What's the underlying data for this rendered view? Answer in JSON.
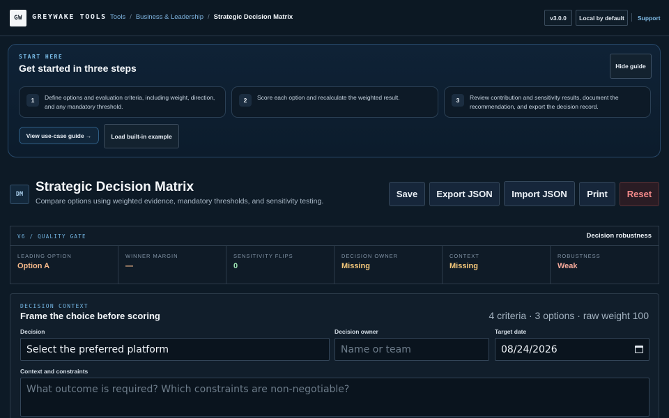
{
  "topbar": {
    "logo": "GW",
    "brand": "GREYWAKE TOOLS",
    "breadcrumb": [
      "Tools",
      "Business & Leadership",
      "Strategic Decision Matrix"
    ],
    "version": "v3.0.0",
    "local_label": "Local by default",
    "support_label": "Support"
  },
  "guide": {
    "kicker": "START HERE",
    "title": "Get started in three steps",
    "hide_label": "Hide guide",
    "steps": [
      {
        "num": "1",
        "text": "Define options and evaluation criteria, including weight, direction, and any mandatory threshold."
      },
      {
        "num": "2",
        "text": "Score each option and recalculate the weighted result."
      },
      {
        "num": "3",
        "text": "Review contribution and sensitivity results, document the recommendation, and export the decision record."
      }
    ],
    "usecase_label": "View use-case guide →",
    "example_label": "Load built-in example"
  },
  "header": {
    "badge": "DM",
    "title": "Strategic Decision Matrix",
    "subtitle": "Compare options using weighted evidence, mandatory thresholds, and sensitivity testing.",
    "actions": {
      "save": "Save",
      "export": "Export JSON",
      "import": "Import JSON",
      "print": "Print",
      "reset": "Reset"
    }
  },
  "quality_gate": {
    "tag": "V6 / QUALITY GATE",
    "right_label": "Decision robustness",
    "metrics": [
      {
        "label": "LEADING OPTION",
        "value": "Option A",
        "color": "#f6b98a"
      },
      {
        "label": "WINNER MARGIN",
        "value": "—",
        "color": "#f6b98a"
      },
      {
        "label": "SENSITIVITY FLIPS",
        "value": "0",
        "color": "#9ee6b5"
      },
      {
        "label": "DECISION OWNER",
        "value": "Missing",
        "color": "#f3c77a"
      },
      {
        "label": "CONTEXT",
        "value": "Missing",
        "color": "#f3c77a"
      },
      {
        "label": "ROBUSTNESS",
        "value": "Weak",
        "color": "#f6a99a"
      }
    ]
  },
  "context": {
    "tag": "DECISION CONTEXT",
    "title": "Frame the choice before scoring",
    "summary": "4 criteria · 3 options · raw weight 100",
    "decision_label": "Decision",
    "decision_value": "Select the preferred platform",
    "owner_label": "Decision owner",
    "owner_placeholder": "Name or team",
    "date_label": "Target date",
    "date_value": "08/24/2026",
    "constraints_label": "Context and constraints",
    "constraints_placeholder": "What outcome is required? Which constraints are non-negotiable?"
  }
}
